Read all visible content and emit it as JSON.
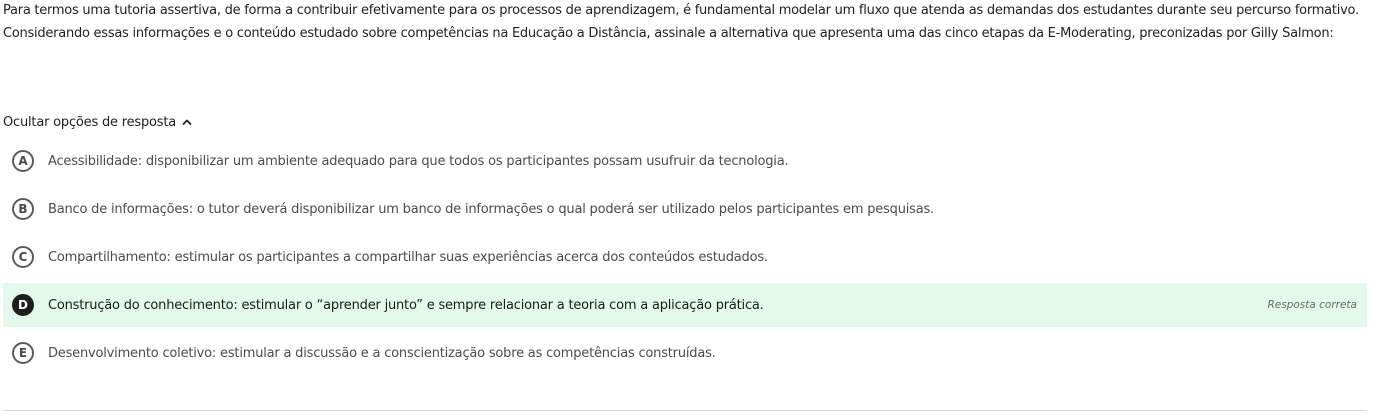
{
  "question": {
    "paragraph1": "Para termos uma tutoria assertiva, de forma a contribuir efetivamente para os processos de aprendizagem, é fundamental modelar um fluxo que atenda as demandas dos estudantes durante seu percurso formativo.",
    "paragraph2": "Considerando essas informações e o conteúdo estudado sobre competências na Educação a Distância, assinale a alternativa que apresenta uma das cinco etapas da E-Moderating, preconizadas por Gilly Salmon:"
  },
  "toggle": {
    "label": "Ocultar opções de resposta",
    "icon": "chevron-up-icon"
  },
  "options": [
    {
      "letter": "A",
      "text": "Acessibilidade: disponibilizar um ambiente adequado para que todos os participantes possam usufruir da tecnologia.",
      "correct": false
    },
    {
      "letter": "B",
      "text": "Banco de informações: o tutor deverá disponibilizar um banco de informações o qual poderá ser utilizado pelos participantes em pesquisas.",
      "correct": false
    },
    {
      "letter": "C",
      "text": "Compartilhamento: estimular os participantes a compartilhar suas experiências acerca dos conteúdos estudados.",
      "correct": false
    },
    {
      "letter": "D",
      "text": "Construção do conhecimento: estimular o “aprender junto” e sempre relacionar a teoria com a aplicação prática.",
      "correct": true,
      "badge": "Resposta correta"
    },
    {
      "letter": "E",
      "text": "Desenvolvimento coletivo: estimular a discussão e a conscientização sobre as competências construídas.",
      "correct": false
    }
  ],
  "colors": {
    "correct_background": "#e2f9ec",
    "selected_letter_background": "#1e1e1e",
    "text": "#212121",
    "option_text": "#4b4b4b",
    "divider": "#d9d9d9"
  }
}
